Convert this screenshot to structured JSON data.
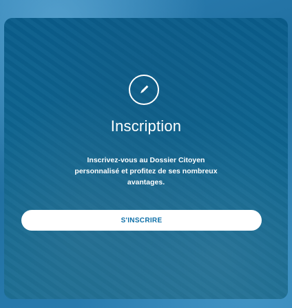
{
  "card": {
    "icon": "pencil-icon",
    "title": "Inscription",
    "description": "Inscrivez-vous au Dossier Citoyen personnalisé et profitez de ses nombreux avantages.",
    "button_label": "S'INSCRIRE"
  },
  "colors": {
    "card_background": "#0b5e8a",
    "page_background": "#2d7fb3",
    "button_background": "#ffffff",
    "button_text": "#0d6fa8",
    "text": "#ffffff"
  }
}
